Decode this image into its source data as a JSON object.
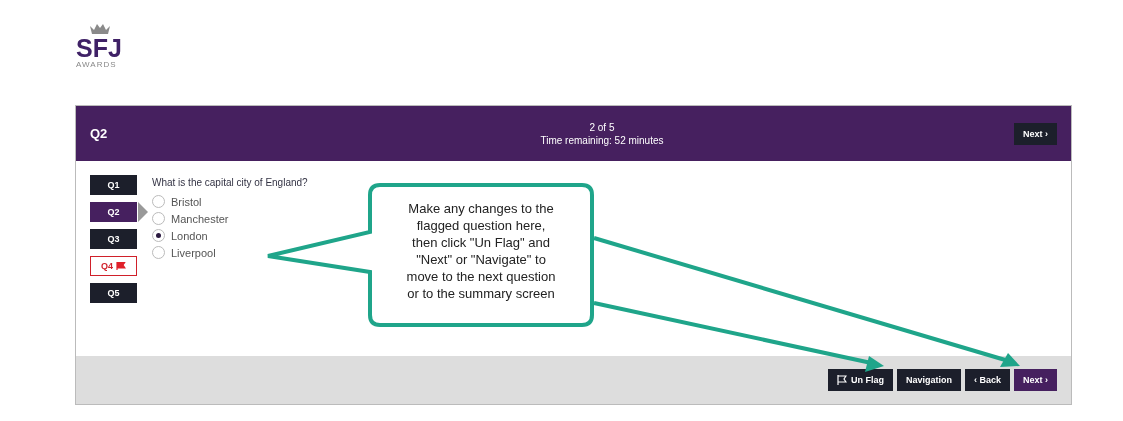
{
  "logo": {
    "name": "SFJ",
    "subtitle": "AWARDS"
  },
  "header": {
    "question": "Q2",
    "progress": "2 of 5",
    "time": "Time remaining: 52 minutes",
    "next": "Next ›"
  },
  "questions": [
    {
      "label": "Q1",
      "selected": false,
      "flagged": false
    },
    {
      "label": "Q2",
      "selected": true,
      "flagged": false
    },
    {
      "label": "Q3",
      "selected": false,
      "flagged": false
    },
    {
      "label": "Q4",
      "selected": false,
      "flagged": true
    },
    {
      "label": "Q5",
      "selected": false,
      "flagged": false
    }
  ],
  "question_text": "What is the capital city of England?",
  "options": [
    {
      "label": "Bristol",
      "selected": false
    },
    {
      "label": "Manchester",
      "selected": false
    },
    {
      "label": "London",
      "selected": true
    },
    {
      "label": "Liverpool",
      "selected": false
    }
  ],
  "callout": "Make any changes to the\nflagged question here,\nthen click \"Un Flag\" and\n\"Next\" or \"Navigate\" to\nmove to the next question\nor to the summary screen",
  "footer": {
    "unflag": "Un Flag",
    "navigation": "Navigation",
    "back": "‹ Back",
    "next": "Next ›"
  }
}
